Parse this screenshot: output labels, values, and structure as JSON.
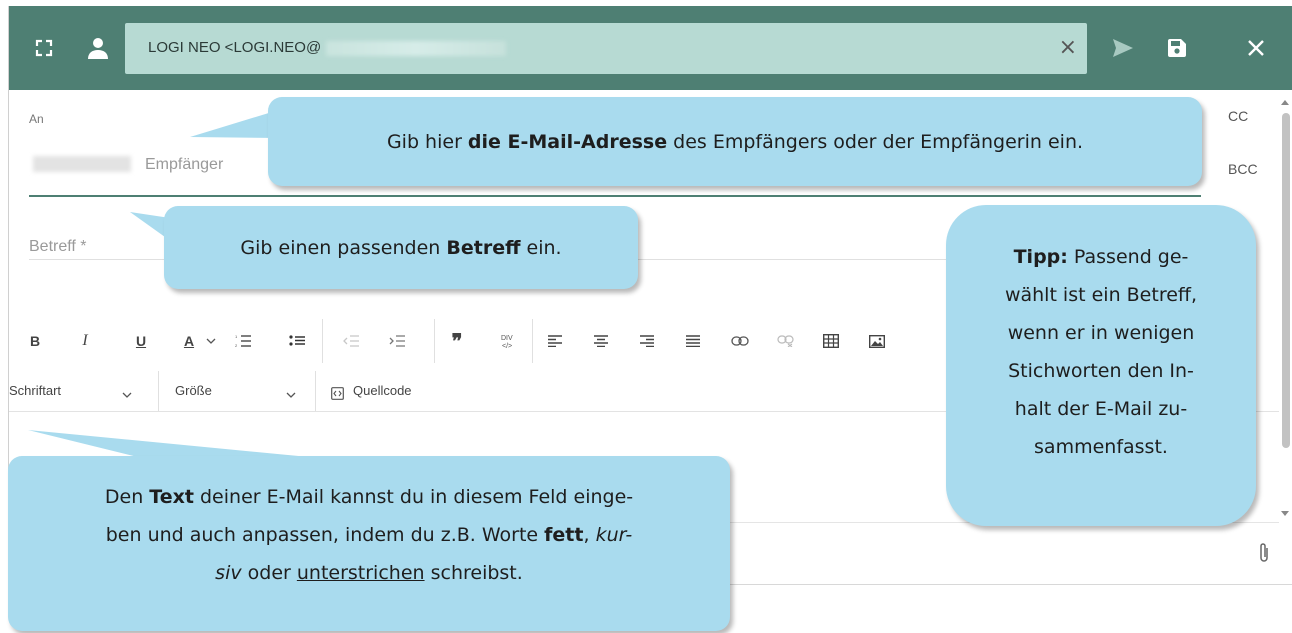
{
  "header": {
    "recipient_label": "LOGI NEO <LOGI.NEO@",
    "icons": [
      "expand-icon",
      "contact-icon",
      "clear-icon",
      "send-icon",
      "save-icon",
      "close-icon"
    ],
    "color": "#4e7f73",
    "recipient_bg": "#b7dad3"
  },
  "form": {
    "to_label": "An",
    "to_placeholder": "Empfänger",
    "cc_label": "CC",
    "bcc_label": "BCC",
    "subject_placeholder": "Betreff *"
  },
  "toolbar": {
    "bold": "B",
    "italic": "I",
    "underline": "U",
    "font_color": "A",
    "font_label": "Schriftart",
    "size_label": "Größe",
    "source_label": "Quellcode"
  },
  "callouts": {
    "email": {
      "before": "Gib hier ",
      "strong": "die E-Mail-Adresse",
      "after": " des Empfängers oder der Empfängerin ein."
    },
    "subject": {
      "before": "Gib einen passenden ",
      "strong": "Betreff",
      "after": " ein."
    },
    "tip": {
      "strong": "Tipp:",
      "line1": " Passend ge-",
      "line2": "wählt ist ein Betreff,",
      "line3": "wenn er in wenigen",
      "line4": "Stichworten den In-",
      "line5": "halt der E-Mail zu-",
      "line6": "sammenfasst."
    },
    "text": {
      "l1_before": "Den ",
      "l1_strong": "Text",
      "l1_after": " deiner E-Mail kannst du in diesem Feld einge-",
      "l2_before": "ben und auch anpassen, indem du z.B. Worte ",
      "l2_strong": "fett",
      "l2_mid": ", ",
      "l2_italic": "kur-",
      "l3_italic": "siv",
      "l3_mid": " oder ",
      "l3_underline": "unterstrichen",
      "l3_after": " schreibst."
    },
    "color": "#a9dbee"
  }
}
